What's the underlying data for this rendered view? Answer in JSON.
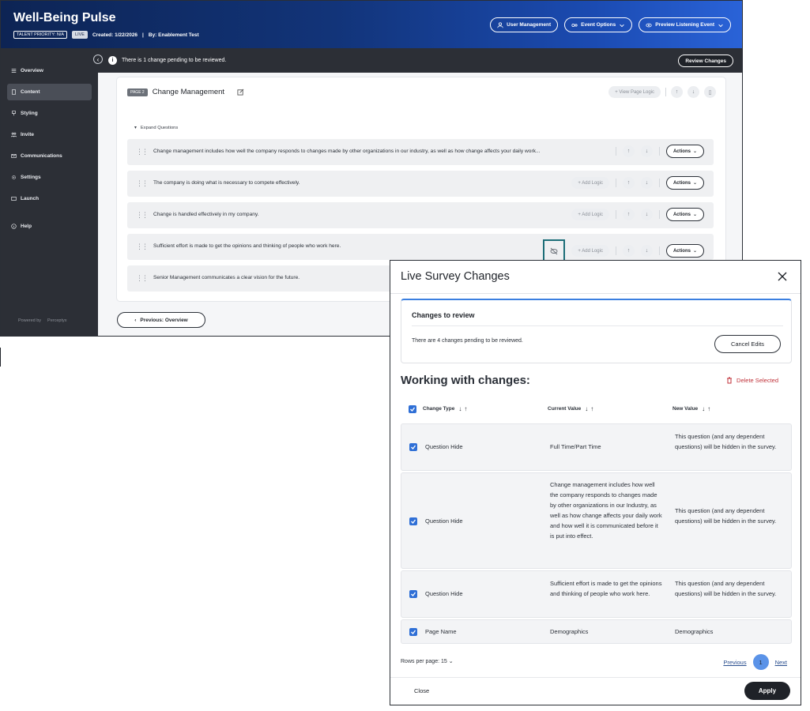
{
  "app": {
    "title": "Well-Being Pulse",
    "talent_priority": "TALENT PRIORITY: N/A",
    "status": "LIVE",
    "created": "Created: 1/22/2026",
    "separator": "|",
    "author": "By: Enablement Test",
    "top_actions": {
      "user_management": "User Management",
      "event_options": "Event Options",
      "preview": "Preview Listening Event"
    }
  },
  "sidebar": {
    "items": [
      {
        "label": "Overview",
        "icon": "list-icon"
      },
      {
        "label": "Content",
        "icon": "document-icon"
      },
      {
        "label": "Styling",
        "icon": "brush-icon"
      },
      {
        "label": "Invite",
        "icon": "people-icon"
      },
      {
        "label": "Communications",
        "icon": "mail-icon"
      },
      {
        "label": "Settings",
        "icon": "gear-icon"
      },
      {
        "label": "Launch",
        "icon": "send-icon"
      },
      {
        "label": "Help",
        "icon": "info-icon"
      }
    ],
    "powered_by": "Powered by",
    "brand": "Perceptyx"
  },
  "banner": {
    "text": "There is 1 change pending to be reviewed.",
    "review_button": "Review Changes"
  },
  "page": {
    "tag": "PAGE 2",
    "name": "Change Management",
    "view_logic": "+ View Page Logic",
    "expand_label": "Expand Questions",
    "add_logic": "+ Add Logic",
    "actions": "Actions",
    "questions": [
      "Change management includes how well the company responds to changes made by other organizations in our industry, as well as how change affects your daily work...",
      "The company is doing what is necessary to compete effectively.",
      "Change is handled effectively in my company.",
      "Sufficient effort is made to get the opinions and thinking of people who work here.",
      "Senior Management communicates a clear vision for the future."
    ],
    "previous_button": "Previous: Overview"
  },
  "modal": {
    "title": "Live Survey Changes",
    "review": {
      "title": "Changes to review",
      "text": "There are 4 changes pending to be reviewed.",
      "cancel": "Cancel Edits"
    },
    "working_title": "Working with changes:",
    "delete_selected": "Delete Selected",
    "columns": [
      "Change Type",
      "Current Value",
      "New Value"
    ],
    "rows": [
      {
        "type": "Question Hide",
        "current": "Full Time/Part Time",
        "new": "This question (and any dependent questions) will be hidden in the survey."
      },
      {
        "type": "Question Hide",
        "current": "Change management includes how well the company responds to changes made by other organizations in our Industry, as well as how change affects your daily work and how well it is communicated before it is put into effect.",
        "new": "This question (and any dependent questions) will be hidden in the survey."
      },
      {
        "type": "Question Hide",
        "current": "Sufficient effort is made to get the opinions and thinking of people who work here.",
        "new": "This question (and any dependent questions) will be hidden in the survey."
      },
      {
        "type": "Page Name",
        "current": "Demographics",
        "new": "Demographics"
      }
    ],
    "rows_per_page_label": "Rows per page:",
    "rows_per_page": "15",
    "pagination": {
      "previous": "Previous",
      "current": "1",
      "next": "Next"
    },
    "close": "Close",
    "apply": "Apply"
  },
  "colors": {
    "accent_blue": "#2f6fd6",
    "danger": "#c0323a",
    "dark": "#1f2228",
    "highlight_teal": "#1d6e78"
  }
}
